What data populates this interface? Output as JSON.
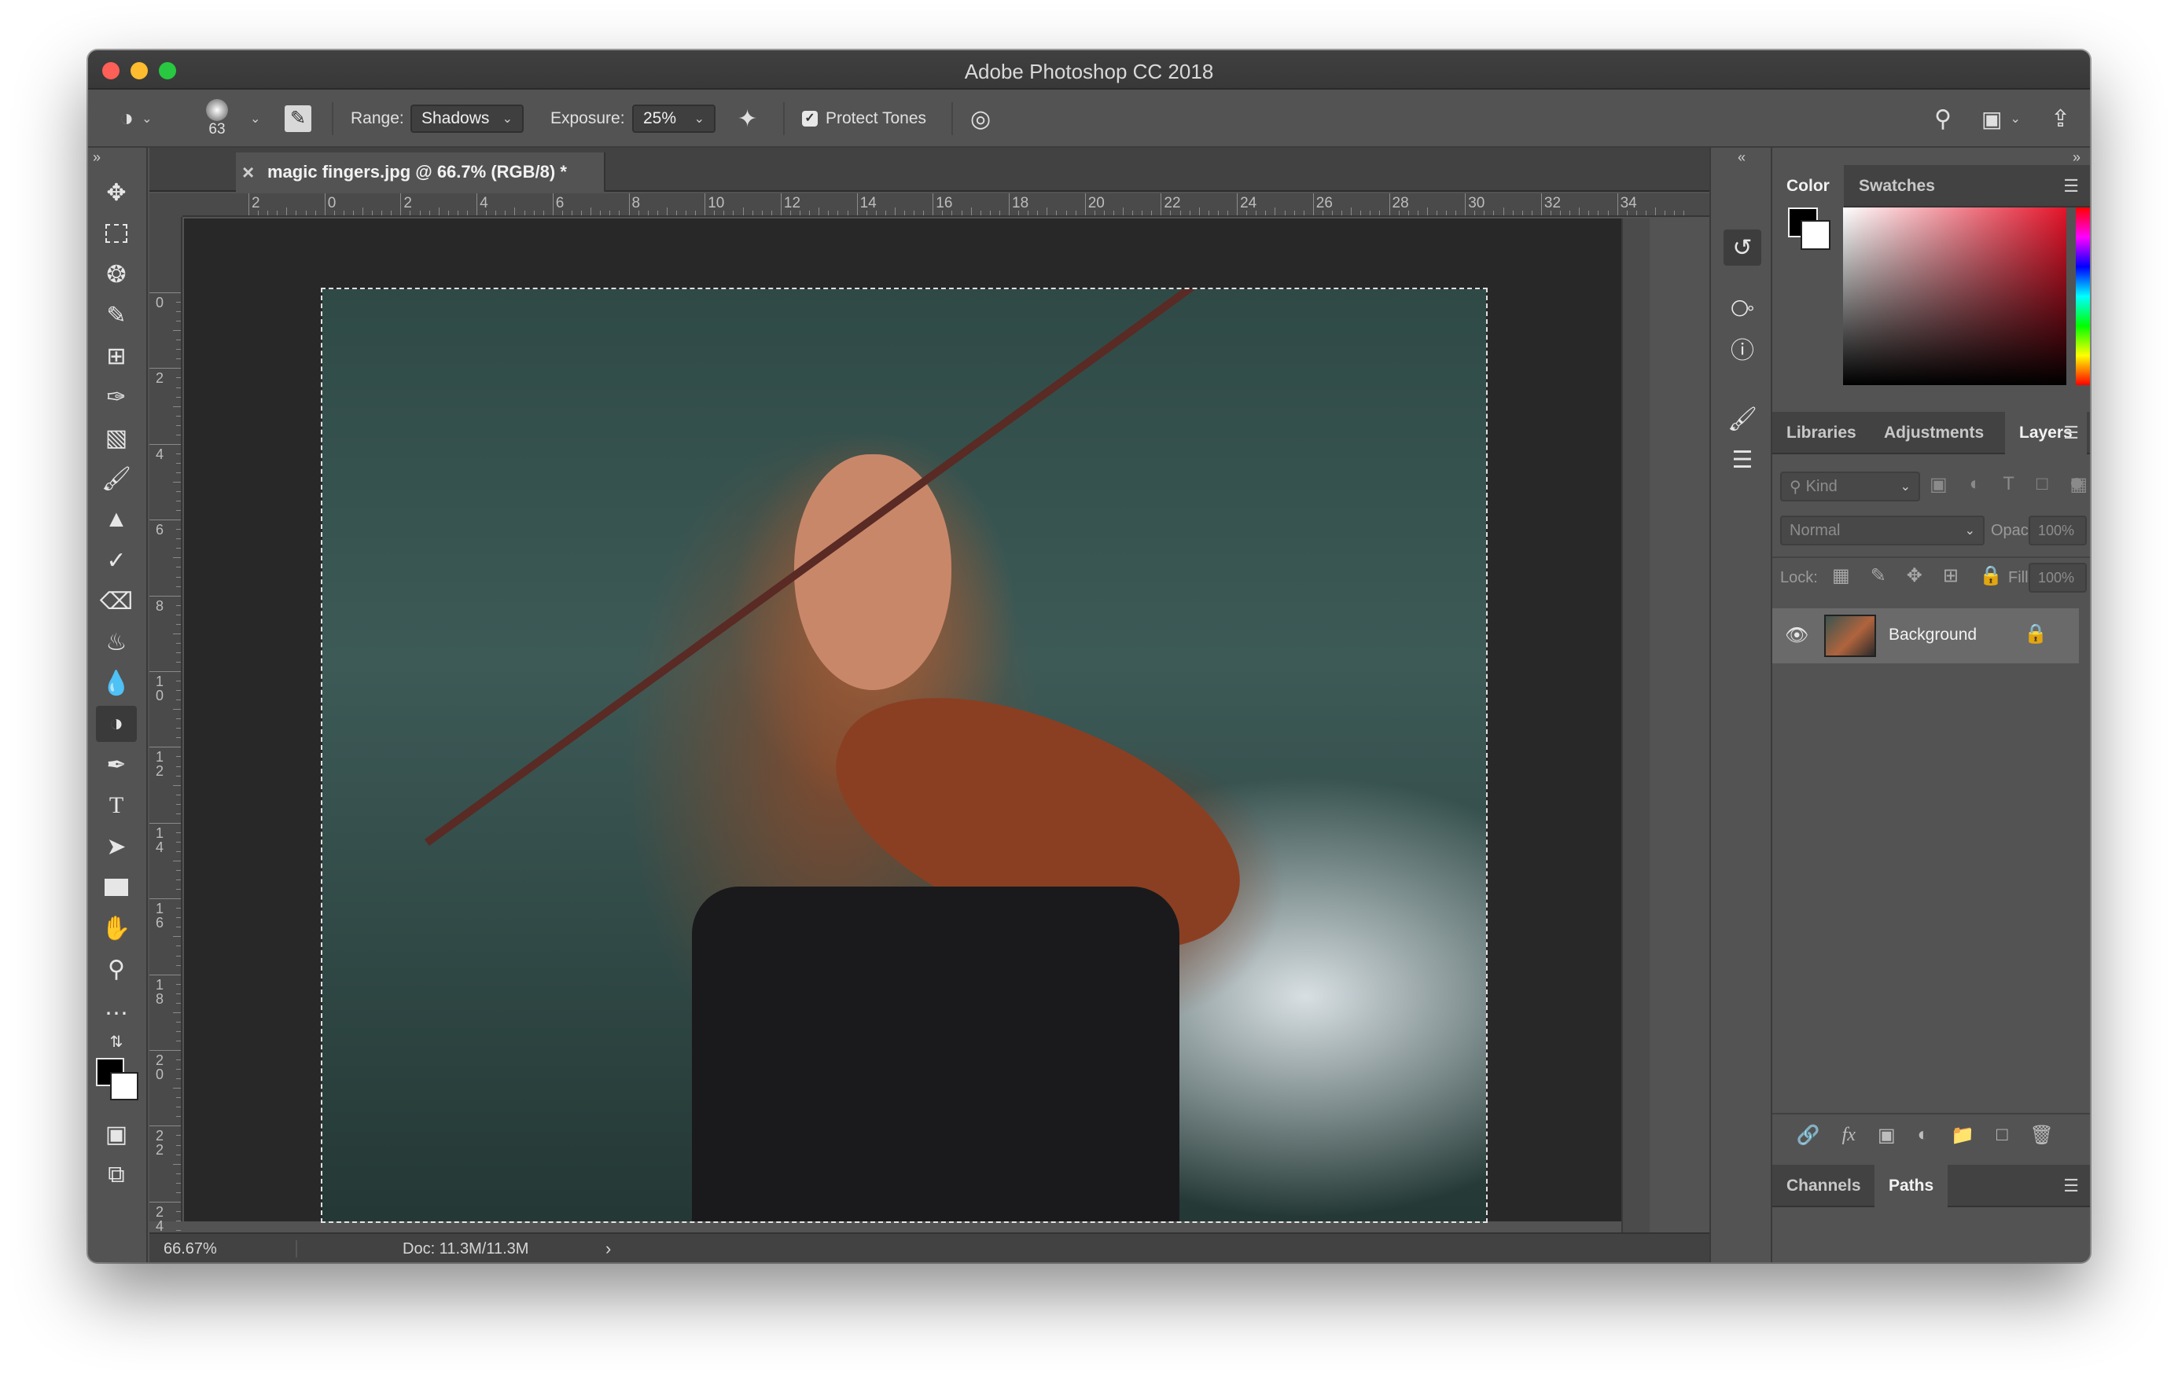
{
  "window": {
    "title": "Adobe Photoshop CC 2018"
  },
  "options_bar": {
    "brush_size": "63",
    "range_label": "Range:",
    "range_value": "Shadows",
    "exposure_label": "Exposure:",
    "exposure_value": "25%",
    "protect_tones_label": "Protect Tones",
    "protect_tones_checked": true
  },
  "document": {
    "tab_title": "magic fingers.jpg @ 66.7% (RGB/8) *",
    "ruler_h": [
      "2",
      "0",
      "2",
      "4",
      "6",
      "8",
      "10",
      "12",
      "14",
      "16",
      "18",
      "20",
      "22",
      "24",
      "26",
      "28",
      "30",
      "32",
      "34"
    ],
    "ruler_v": [
      "0",
      "2",
      "4",
      "6",
      "8",
      "10",
      "12",
      "14",
      "16",
      "18",
      "20",
      "22",
      "24"
    ],
    "zoom": "66.67%",
    "doc_size": "Doc: 11.3M/11.3M"
  },
  "panels": {
    "color_tabs": [
      "Color",
      "Swatches"
    ],
    "layers_tabs": [
      "Libraries",
      "Adjustments",
      "Layers"
    ],
    "filter_kind": "Kind",
    "blend_mode": "Normal",
    "opacity_label": "Opacity:",
    "opacity_value": "100%",
    "lock_label": "Lock:",
    "fill_label": "Fill:",
    "fill_value": "100%",
    "layers": [
      {
        "name": "Background",
        "visible": true,
        "locked": true
      }
    ],
    "bottom_tabs": [
      "Channels",
      "Paths"
    ]
  },
  "colors": {
    "foreground": "#000000",
    "background": "#ffffff",
    "ui_bg": "#535353"
  }
}
